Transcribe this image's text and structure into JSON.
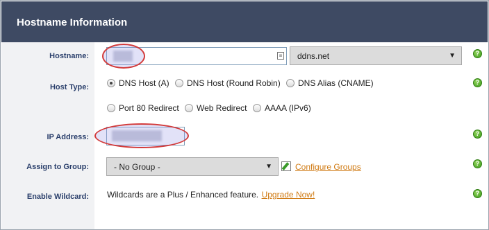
{
  "header": {
    "title": "Hostname Information"
  },
  "labels": {
    "hostname": "Hostname:",
    "host_type": "Host Type:",
    "ip_address": "IP Address:",
    "assign_group": "Assign to Group:",
    "enable_wildcard": "Enable Wildcard:"
  },
  "hostname": {
    "value": "",
    "domain": "ddns.net"
  },
  "host_type": {
    "options": [
      "DNS Host (A)",
      "DNS Host (Round Robin)",
      "DNS Alias (CNAME)",
      "Port 80 Redirect",
      "Web Redirect",
      "AAAA (IPv6)"
    ],
    "selected": "DNS Host (A)"
  },
  "ip_address": {
    "value": ""
  },
  "group": {
    "selected": "- No Group -",
    "configure_label": "Configure Groups"
  },
  "wildcard": {
    "text": "Wildcards are a Plus / Enhanced feature.",
    "upgrade_label": "Upgrade Now!"
  },
  "help": {
    "glyph": "?"
  },
  "colors": {
    "header_bg": "#3e4a63",
    "label_text": "#2a3f6b",
    "link": "#d07a12",
    "annotation": "#d33b3b"
  }
}
